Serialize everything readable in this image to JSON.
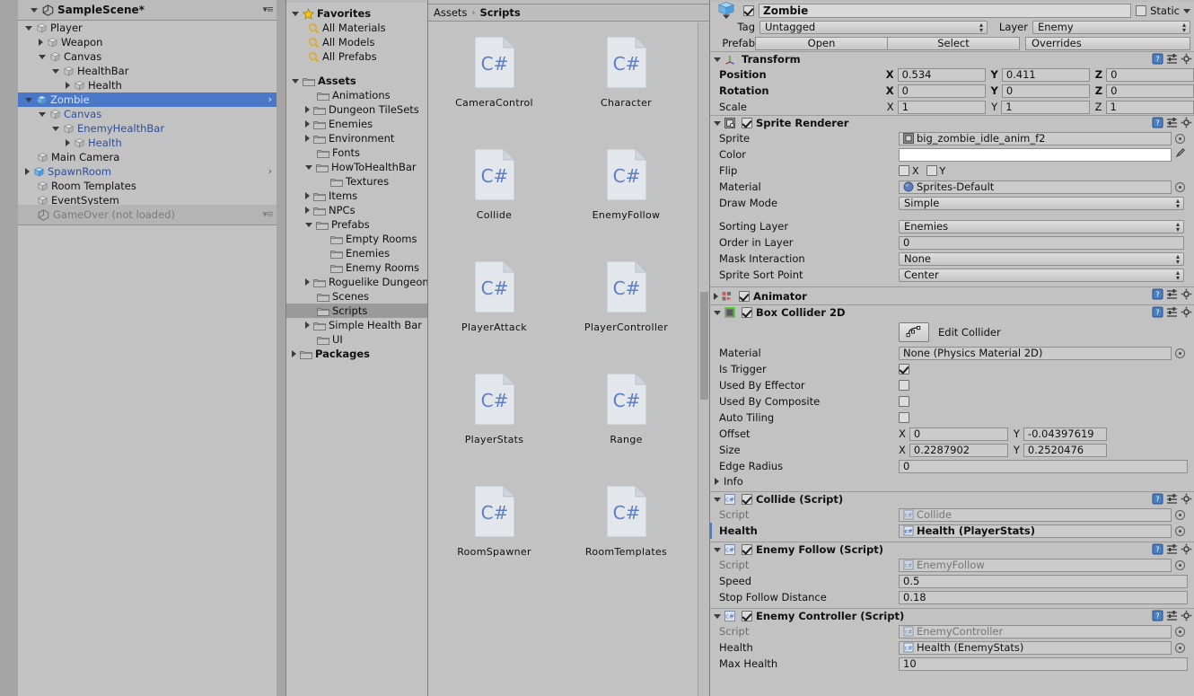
{
  "hierarchy": {
    "scene": {
      "name": "SampleScene*",
      "icon": "unity-scene-icon",
      "options_icon": "scene-options-icon"
    },
    "items": [
      {
        "label": "Player",
        "depth": 1,
        "expand": "down",
        "icon": "gameobject-cube-icon",
        "prefab": false,
        "selected": false
      },
      {
        "label": "Weapon",
        "depth": 2,
        "expand": "right",
        "icon": "gameobject-cube-icon",
        "prefab": false,
        "selected": false
      },
      {
        "label": "Canvas",
        "depth": 2,
        "expand": "down",
        "icon": "gameobject-cube-icon",
        "prefab": false,
        "selected": false
      },
      {
        "label": "HealthBar",
        "depth": 3,
        "expand": "down",
        "icon": "gameobject-cube-icon",
        "prefab": false,
        "selected": false
      },
      {
        "label": "Health",
        "depth": 4,
        "expand": "right",
        "icon": "gameobject-cube-icon",
        "prefab": false,
        "selected": false
      },
      {
        "label": "Zombie",
        "depth": 1,
        "expand": "down",
        "icon": "prefab-cube-icon",
        "prefab": true,
        "selected": true,
        "chevron": true
      },
      {
        "label": "Canvas",
        "depth": 2,
        "expand": "down",
        "icon": "gameobject-cube-icon",
        "prefab": true,
        "selected": false
      },
      {
        "label": "EnemyHealthBar",
        "depth": 3,
        "expand": "down",
        "icon": "gameobject-cube-icon",
        "prefab": true,
        "selected": false
      },
      {
        "label": "Health",
        "depth": 4,
        "expand": "right",
        "icon": "gameobject-cube-icon",
        "prefab": true,
        "selected": false
      },
      {
        "label": "Main Camera",
        "depth": 1,
        "expand": "none",
        "icon": "gameobject-cube-icon",
        "prefab": false,
        "selected": false
      },
      {
        "label": "SpawnRoom",
        "depth": 1,
        "expand": "right",
        "icon": "prefab-cube-icon",
        "prefab": true,
        "selected": false,
        "chevron": true
      },
      {
        "label": "Room Templates",
        "depth": 1,
        "expand": "none",
        "icon": "gameobject-cube-icon",
        "prefab": false,
        "selected": false
      },
      {
        "label": "EventSystem",
        "depth": 1,
        "expand": "none",
        "icon": "gameobject-cube-icon",
        "prefab": false,
        "selected": false
      }
    ],
    "unloaded_scene": {
      "name": "GameOver (not loaded)",
      "icon": "unity-scene-icon",
      "options_icon": "scene-options-icon"
    }
  },
  "project": {
    "favorites": {
      "label": "Favorites",
      "icon": "star-icon",
      "items": [
        {
          "label": "All Materials",
          "icon": "search-icon"
        },
        {
          "label": "All Models",
          "icon": "search-icon"
        },
        {
          "label": "All Prefabs",
          "icon": "search-icon"
        }
      ]
    },
    "tree": [
      {
        "label": "Assets",
        "depth": 0,
        "expand": "down",
        "bold": true,
        "selected": false
      },
      {
        "label": "Animations",
        "depth": 1,
        "expand": "none",
        "bold": false,
        "selected": false
      },
      {
        "label": "Dungeon TileSets",
        "depth": 1,
        "expand": "right",
        "bold": false,
        "selected": false
      },
      {
        "label": "Enemies",
        "depth": 1,
        "expand": "right",
        "bold": false,
        "selected": false
      },
      {
        "label": "Environment",
        "depth": 1,
        "expand": "right",
        "bold": false,
        "selected": false
      },
      {
        "label": "Fonts",
        "depth": 1,
        "expand": "none",
        "bold": false,
        "selected": false
      },
      {
        "label": "HowToHealthBar",
        "depth": 1,
        "expand": "down",
        "bold": false,
        "selected": false
      },
      {
        "label": "Textures",
        "depth": 2,
        "expand": "none",
        "bold": false,
        "selected": false
      },
      {
        "label": "Items",
        "depth": 1,
        "expand": "right",
        "bold": false,
        "selected": false
      },
      {
        "label": "NPCs",
        "depth": 1,
        "expand": "right",
        "bold": false,
        "selected": false
      },
      {
        "label": "Prefabs",
        "depth": 1,
        "expand": "down",
        "bold": false,
        "selected": false
      },
      {
        "label": "Empty Rooms",
        "depth": 2,
        "expand": "none",
        "bold": false,
        "selected": false
      },
      {
        "label": "Enemies",
        "depth": 2,
        "expand": "none",
        "bold": false,
        "selected": false
      },
      {
        "label": "Enemy Rooms",
        "depth": 2,
        "expand": "none",
        "bold": false,
        "selected": false
      },
      {
        "label": "Roguelike Dungeon",
        "depth": 1,
        "expand": "right",
        "bold": false,
        "selected": false
      },
      {
        "label": "Scenes",
        "depth": 1,
        "expand": "none",
        "bold": false,
        "selected": false
      },
      {
        "label": "Scripts",
        "depth": 1,
        "expand": "none",
        "bold": false,
        "selected": true
      },
      {
        "label": "Simple Health Bar",
        "depth": 1,
        "expand": "right",
        "bold": false,
        "selected": false
      },
      {
        "label": "UI",
        "depth": 1,
        "expand": "none",
        "bold": false,
        "selected": false
      },
      {
        "label": "Packages",
        "depth": 0,
        "expand": "right",
        "bold": true,
        "selected": false
      }
    ]
  },
  "browser": {
    "breadcrumb": {
      "root": "Assets",
      "separator": "›",
      "current": "Scripts"
    },
    "assets": [
      {
        "name": "CameraControl",
        "icon": "csharp-script-icon"
      },
      {
        "name": "Character",
        "icon": "csharp-script-icon"
      },
      {
        "name": "Collide",
        "icon": "csharp-script-icon"
      },
      {
        "name": "EnemyFollow",
        "icon": "csharp-script-icon"
      },
      {
        "name": "PlayerAttack",
        "icon": "csharp-script-icon"
      },
      {
        "name": "PlayerController",
        "icon": "csharp-script-icon"
      },
      {
        "name": "PlayerStats",
        "icon": "csharp-script-icon"
      },
      {
        "name": "Range",
        "icon": "csharp-script-icon"
      },
      {
        "name": "RoomSpawner",
        "icon": "csharp-script-icon"
      },
      {
        "name": "RoomTemplates",
        "icon": "csharp-script-icon"
      }
    ],
    "csharp_glyph": "C#"
  },
  "inspector": {
    "object": {
      "name": "Zombie",
      "enabled": true,
      "static_label": "Static",
      "static_checked": false
    },
    "tag": {
      "label": "Tag",
      "value": "Untagged"
    },
    "layer": {
      "label": "Layer",
      "value": "Enemy"
    },
    "prefab": {
      "label": "Prefab",
      "open": "Open",
      "select": "Select",
      "overrides": "Overrides"
    },
    "transform": {
      "title": "Transform",
      "icon": "transform-axis-icon",
      "rows": [
        {
          "label": "Position",
          "bold": true,
          "x": "0.534",
          "y": "0.411",
          "z": "0"
        },
        {
          "label": "Rotation",
          "bold": true,
          "x": "0",
          "y": "0",
          "z": "0"
        },
        {
          "label": "Scale",
          "bold": false,
          "x": "1",
          "y": "1",
          "z": "1"
        }
      ]
    },
    "sprite_renderer": {
      "title": "Sprite Renderer",
      "icon": "sprite-renderer-icon",
      "enabled": true,
      "sprite": {
        "label": "Sprite",
        "value": "big_zombie_idle_anim_f2"
      },
      "color": {
        "label": "Color",
        "swatch": "#ffffff"
      },
      "flip": {
        "label": "Flip",
        "x_label": "X",
        "y_label": "Y",
        "x": false,
        "y": false
      },
      "material": {
        "label": "Material",
        "value": "Sprites-Default"
      },
      "draw_mode": {
        "label": "Draw Mode",
        "value": "Simple"
      },
      "sorting_layer": {
        "label": "Sorting Layer",
        "value": "Enemies"
      },
      "order_in_layer": {
        "label": "Order in Layer",
        "value": "0"
      },
      "mask_interaction": {
        "label": "Mask Interaction",
        "value": "None"
      },
      "sprite_sort_point": {
        "label": "Sprite Sort Point",
        "value": "Center"
      }
    },
    "animator": {
      "title": "Animator",
      "icon": "animator-icon",
      "enabled": true,
      "collapsed": true
    },
    "box_collider": {
      "title": "Box Collider 2D",
      "icon": "box-collider-2d-icon",
      "enabled": true,
      "edit_collider": {
        "label": "Edit Collider",
        "icon": "edit-collider-icon"
      },
      "material": {
        "label": "Material",
        "value": "None (Physics Material 2D)"
      },
      "is_trigger": {
        "label": "Is Trigger",
        "checked": true
      },
      "used_by_effector": {
        "label": "Used By Effector",
        "checked": false
      },
      "used_by_composite": {
        "label": "Used By Composite",
        "checked": false
      },
      "auto_tiling": {
        "label": "Auto Tiling",
        "checked": false
      },
      "offset": {
        "label": "Offset",
        "x": "0",
        "y": "-0.04397619"
      },
      "size": {
        "label": "Size",
        "x": "0.2287902",
        "y": "0.2520476"
      },
      "edge_radius": {
        "label": "Edge Radius",
        "value": "0"
      },
      "info": {
        "label": "Info"
      }
    },
    "collide_script": {
      "title": "Collide (Script)",
      "icon": "csharp-component-icon",
      "enabled": true,
      "script": {
        "label": "Script",
        "value": "Collide"
      },
      "health": {
        "label": "Health",
        "value": "Health (PlayerStats)",
        "overridden": true
      }
    },
    "enemy_follow_script": {
      "title": "Enemy Follow (Script)",
      "icon": "csharp-component-icon",
      "enabled": true,
      "script": {
        "label": "Script",
        "value": "EnemyFollow"
      },
      "speed": {
        "label": "Speed",
        "value": "0.5"
      },
      "stop_follow_distance": {
        "label": "Stop Follow Distance",
        "value": "0.18"
      }
    },
    "enemy_controller_script": {
      "title": "Enemy Controller (Script)",
      "icon": "csharp-component-icon",
      "enabled": true,
      "script": {
        "label": "Script",
        "value": "EnemyController"
      },
      "health": {
        "label": "Health",
        "value": "Health (EnemyStats)"
      },
      "max_health": {
        "label": "Max Health",
        "value": "10"
      }
    },
    "component_icons": {
      "help": "help-icon",
      "preset": "preset-icon",
      "gear": "gear-icon"
    }
  },
  "colors": {
    "selection_blue": "#4a78c8",
    "prefab_text_blue": "#2d4f9e",
    "override_bar_blue": "#3e7fd5",
    "panel_bg": "#c2c2c2",
    "csharp_blue": "#5b7fc7"
  }
}
